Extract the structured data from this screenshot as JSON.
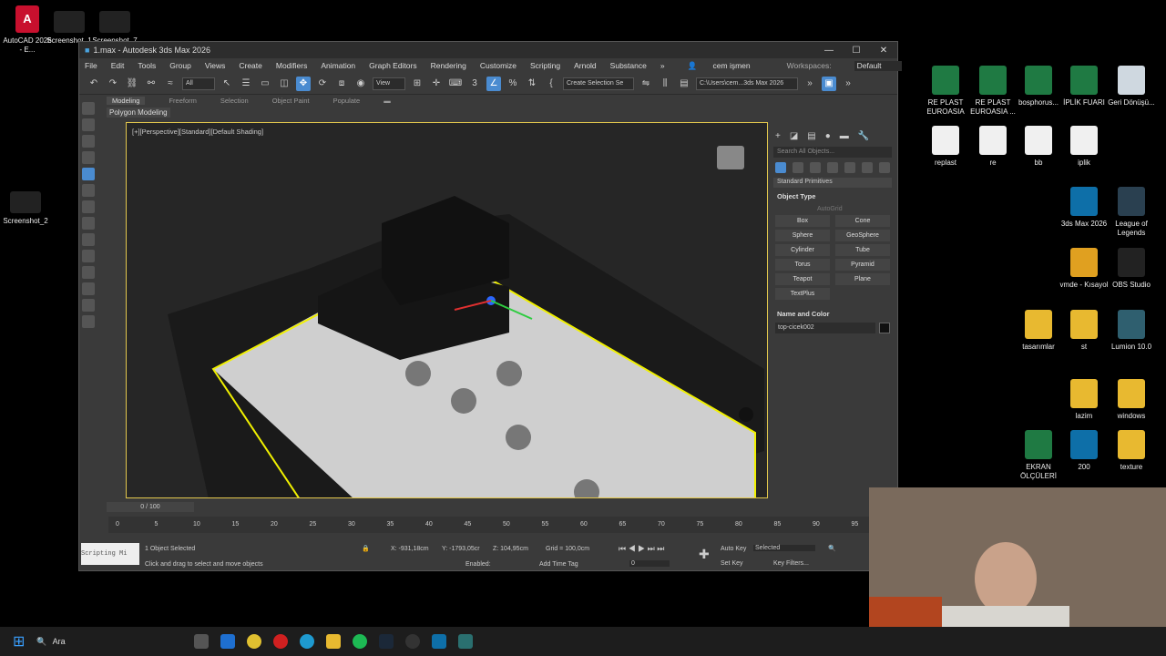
{
  "window": {
    "title": "1.max - Autodesk 3ds Max 2026",
    "controls": [
      "—",
      "☐",
      "✕"
    ]
  },
  "menu": [
    "File",
    "Edit",
    "Tools",
    "Group",
    "Views",
    "Create",
    "Modifiers",
    "Animation",
    "Graph Editors",
    "Rendering",
    "Customize",
    "Scripting",
    "Arnold",
    "Substance"
  ],
  "user": "cem işmen",
  "workspaces": {
    "label": "Workspaces:",
    "value": "Default"
  },
  "toolbar": {
    "filter": "All",
    "view": "View",
    "selection_set": "Create Selection Se",
    "path": "C:\\Users\\cem...3ds Max 2026"
  },
  "ribbon": {
    "tabs": [
      "Modeling",
      "Freeform",
      "Selection",
      "Object Paint",
      "Populate"
    ],
    "active": "Modeling",
    "subtab": "Polygon Modeling"
  },
  "viewport": {
    "label": "[+][Perspective][Standard][Default Shading]"
  },
  "command_panel": {
    "search_placeholder": "Search All Objects...",
    "dropdown": "Standard Primitives",
    "object_type": "Object Type",
    "autogrid": "AutoGrid",
    "buttons": [
      "Box",
      "Cone",
      "Sphere",
      "GeoSphere",
      "Cylinder",
      "Tube",
      "Torus",
      "Pyramid",
      "Teapot",
      "Plane",
      "TextPlus"
    ],
    "name_color": "Name and Color",
    "object_name": "top-cicek002"
  },
  "timeline": {
    "frame": "0 / 100",
    "ticks": [
      "0",
      "5",
      "10",
      "15",
      "20",
      "25",
      "30",
      "35",
      "40",
      "45",
      "50",
      "55",
      "60",
      "65",
      "70",
      "75",
      "80",
      "85",
      "90",
      "95",
      "100"
    ]
  },
  "status": {
    "selected": "1 Object Selected",
    "hint": "Click and drag to select and move objects",
    "x": "X: -931,18cm",
    "y": "Y: -1793,05cr",
    "z": "Z: 104,95cm",
    "grid": "Grid = 100,0cm",
    "enabled": "Enabled:",
    "add_time_tag": "Add Time Tag",
    "auto_key": "Auto Key",
    "set_key": "Set Key",
    "key_mode": "Selected",
    "key_filters": "Key Filters...",
    "frame_value": "0",
    "script": "Scripting Mi"
  },
  "desktop": {
    "left_icons": [
      {
        "label": "AutoCAD 2026 - E..."
      },
      {
        "label": "Screenshot_1"
      },
      {
        "label": "Screenshot_7"
      },
      {
        "label": "Screenshot_2"
      }
    ],
    "right_icons": [
      {
        "label": "RE PLAST EUROASIA",
        "type": "xl"
      },
      {
        "label": "RE PLAST EUROASIA ...",
        "type": "xl"
      },
      {
        "label": "bosphorus...",
        "type": "xl"
      },
      {
        "label": "İPLİK FUARI",
        "type": "xl"
      },
      {
        "label": "Geri Dönüşü...",
        "type": "bin"
      },
      {
        "label": "replast",
        "type": "doc"
      },
      {
        "label": "re",
        "type": "doc"
      },
      {
        "label": "bb",
        "type": "doc"
      },
      {
        "label": "iplik",
        "type": "doc"
      },
      {
        "label": "3ds Max 2026",
        "type": "max"
      },
      {
        "label": "League of Legends",
        "type": "lol"
      },
      {
        "label": "vmde - Kısayol",
        "type": "vm"
      },
      {
        "label": "OBS Studio",
        "type": "obs"
      },
      {
        "label": "tasarımlar",
        "type": "fold"
      },
      {
        "label": "st",
        "type": "fold"
      },
      {
        "label": "Lumion 10.0",
        "type": "lum"
      },
      {
        "label": "lazim",
        "type": "fold"
      },
      {
        "label": "windows",
        "type": "fold"
      },
      {
        "label": "EKRAN ÖLÇÜLERİ",
        "type": "xl"
      },
      {
        "label": "200",
        "type": "max"
      },
      {
        "label": "texture",
        "type": "fold"
      }
    ]
  },
  "taskbar": {
    "search": "Ara"
  }
}
